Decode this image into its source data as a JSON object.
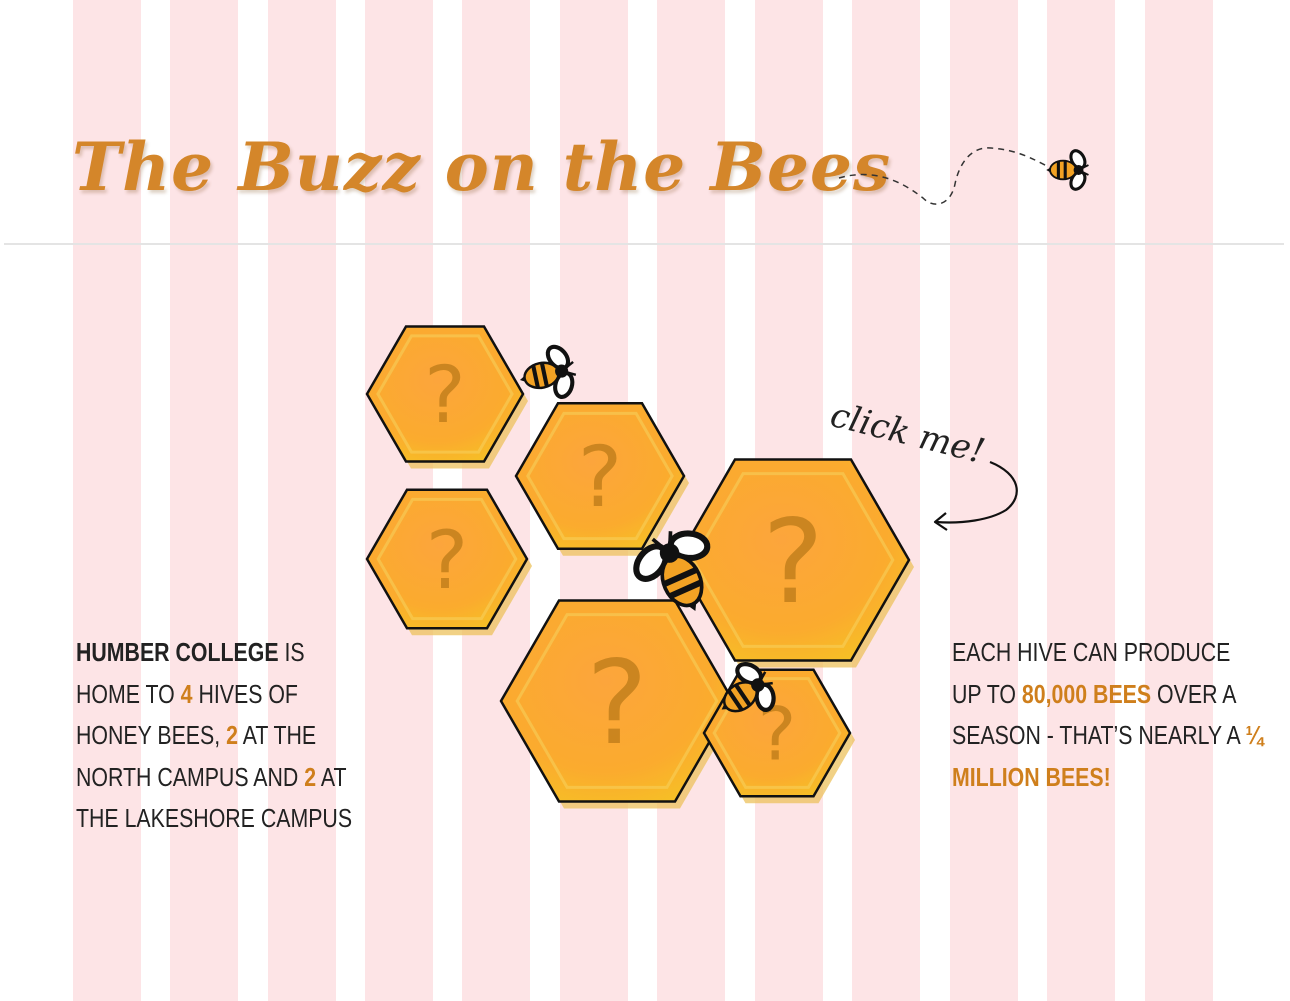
{
  "header": {
    "title": "The Buzz on the Bees"
  },
  "hint": {
    "label": "click me!"
  },
  "hexes": [
    "?",
    "?",
    "?",
    "?",
    "?",
    "?"
  ],
  "left_text": {
    "p1": "Humber College",
    "p2": " is home to ",
    "p3": "4",
    "p4": " hives of honey bees, ",
    "p5": "2",
    "p6": " at the North Campus and ",
    "p7": "2",
    "p8": " at the Lakeshore Campus"
  },
  "right_text": {
    "p1": " Each hive can produce up to ",
    "p2": "80,000 bees",
    "p3": " over a season - that’s nearly a ",
    "p4": "¼ million bees!"
  },
  "colors": {
    "stripe": "#fde4e6",
    "title": "#d4862a",
    "accent": "#cf7f1c",
    "honey": "#f9a928",
    "outline": "#111111"
  },
  "icons": [
    "bee-icon",
    "curved-arrow-icon",
    "dashed-flight-path-icon"
  ]
}
